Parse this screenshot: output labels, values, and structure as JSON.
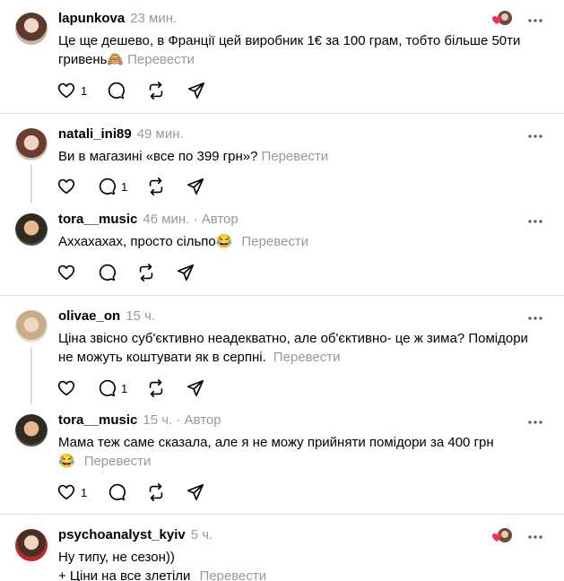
{
  "comments": [
    {
      "username": "lapunkova",
      "time": "23 мин.",
      "text": "Це ще дешево, в Франції цей виробник 1€ за 100 грам, тобто більше 50ти гривень🙈",
      "translate": "Перевести",
      "like_count": "1",
      "reply_count": ""
    },
    {
      "username": "natali_ini89",
      "time": "49 мин.",
      "text": "Ви в магазині «все по 399 грн»?",
      "translate": "Перевести",
      "like_count": "",
      "reply_count": "1"
    },
    {
      "username": "tora__music",
      "time": "46 мин.",
      "author_badge": "· Автор",
      "text": "Аххахахах, просто сільпо😂",
      "translate": "Перевести",
      "like_count": "",
      "reply_count": ""
    },
    {
      "username": "olivae_on",
      "time": "15 ч.",
      "text": "Ціна звісно суб'єктивно неадекватно, але об'єктивно- це ж зима? Помідори не можуть коштувати як в серпні.",
      "translate": "Перевести",
      "like_count": "",
      "reply_count": "1"
    },
    {
      "username": "tora__music",
      "time": "15 ч.",
      "author_badge": "· Автор",
      "text": "Мама теж саме сказала, але я не можу прийняти помідори за 400 грн 😂",
      "translate": "Перевести",
      "like_count": "1",
      "reply_count": ""
    },
    {
      "username": "psychoanalyst_kyiv",
      "time": "5 ч.",
      "text_line1": "Ну типу, не сезон))",
      "text_line2": "+ Ціни на все злетіли",
      "translate": "Перевести"
    }
  ],
  "colors": {
    "heart": "#ff2d55",
    "muted": "#999999",
    "divider": "#e0e0e0"
  }
}
